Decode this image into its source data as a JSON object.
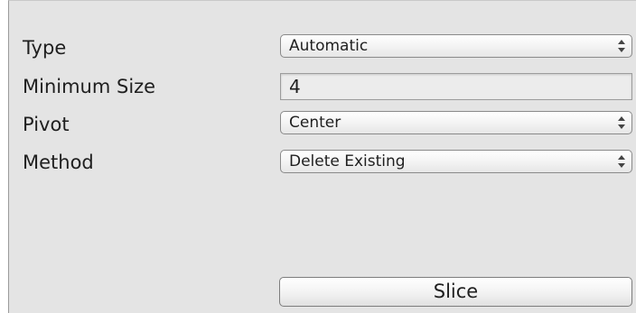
{
  "fields": {
    "type": {
      "label": "Type",
      "value": "Automatic"
    },
    "minimum_size": {
      "label": "Minimum Size",
      "value": "4"
    },
    "pivot": {
      "label": "Pivot",
      "value": "Center"
    },
    "method": {
      "label": "Method",
      "value": "Delete Existing"
    }
  },
  "actions": {
    "slice_label": "Slice"
  },
  "icons": {
    "dropdown_arrows": "up-down-arrows-icon"
  },
  "colors": {
    "panel_background": "#e4e4e4",
    "text": "#1f1f1f"
  }
}
